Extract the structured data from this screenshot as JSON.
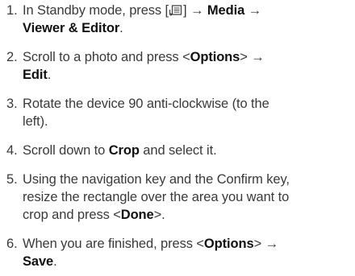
{
  "steps": [
    {
      "number": "1.",
      "line1_pre": "In Standby mode, press [",
      "menu_icon": "menu-key-icon",
      "line1_post": "] → ",
      "line1_bold": "Media",
      "line1_arrow": " →",
      "line2_bold": "Viewer & Editor",
      "line2_end": "."
    },
    {
      "number": "2.",
      "line1_pre": "Scroll to a photo and press <",
      "line1_bold": "Options",
      "line1_post": "> →",
      "line2_bold": "Edit",
      "line2_end": "."
    },
    {
      "number": "3.",
      "line1": "Rotate the device 90 anti-clockwise (to the",
      "line2": "left)."
    },
    {
      "number": "4.",
      "line1_pre": "Scroll down to ",
      "line1_bold": "Crop",
      "line1_post": " and select it."
    },
    {
      "number": "5.",
      "line1": "Using the navigation key and the Confirm key,",
      "line2": "resize the rectangle over the area you want to",
      "line3_pre": "crop and press <",
      "line3_bold": "Done",
      "line3_post": ">."
    },
    {
      "number": "6.",
      "line1_pre": "When you are finished, press <",
      "line1_bold": "Options",
      "line1_post": "> →",
      "line2_bold": "Save",
      "line2_end": "."
    }
  ]
}
